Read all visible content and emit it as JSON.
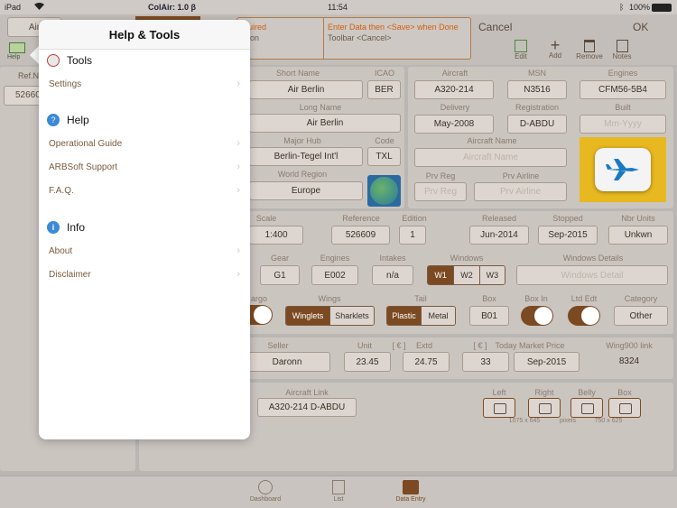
{
  "status": {
    "device": "iPad",
    "app": "ColAir: 1.0 β",
    "time": "11:54",
    "battery": "100%"
  },
  "toolbar": {
    "left_tab": "Air",
    "help_label": "Help",
    "hint_required": "uired",
    "hint_req2": "ion",
    "hint_enter": "Enter Data then <Save> when Done",
    "hint_toolbar": "Toolbar <Cancel>",
    "cancel": "Cancel",
    "ok": "OK",
    "edit": "Edit",
    "add": "Add",
    "remove": "Remove",
    "notes": "Notes"
  },
  "left_list": {
    "header": "Ref.N",
    "value": "52660"
  },
  "airline": {
    "short_name_label": "Short  Name",
    "short_name": "Air Berlin",
    "icao_label": "ICAO",
    "icao": "BER",
    "long_name_label": "Long Name",
    "long_name": "Air Berlin",
    "hub_label": "Major Hub",
    "hub": "Berlin-Tegel Int'l",
    "code_label": "Code",
    "code": "TXL",
    "region_label": "World Region",
    "region": "Europe"
  },
  "aircraft": {
    "aircraft_label": "Aircraft",
    "aircraft": "A320-214",
    "msn_label": "MSN",
    "msn": "N3516",
    "engines_label": "Engines",
    "engines": "CFM56-5B4",
    "delivery_label": "Delivery",
    "delivery": "May-2008",
    "registration_label": "Registration",
    "registration": "D-ABDU",
    "built_label": "Built",
    "built": "Mm-Yyyy",
    "name_label": "Aircraft Name",
    "name": "Aircraft Name",
    "prv_reg_label": "Prv Reg",
    "prv_reg": "Prv Reg",
    "prv_airline_label": "Prv Airline",
    "prv_airline": "Prv Airline"
  },
  "model": {
    "scale_label": "Scale",
    "scale": "1:400",
    "reference_label": "Reference",
    "reference": "526609",
    "edition_label": "Edition",
    "edition": "1",
    "released_label": "Released",
    "released": "Jun-2014",
    "stopped_label": "Stopped",
    "stopped": "Sep-2015",
    "units_label": "Nbr Units",
    "units": "Unkwn",
    "gear_label": "Gear",
    "gear": "G1",
    "engines_label": "Engines",
    "engines": "E002",
    "intakes_label": "Intakes",
    "intakes": "n/a",
    "windows_label": "Windows",
    "windows": [
      "W1",
      "W2",
      "W3"
    ],
    "windows_details_label": "Windows Details",
    "windows_details": "Windows Detail",
    "cargo_label": "argo",
    "wings_label": "Wings",
    "wings": [
      "Winglets",
      "Sharklets"
    ],
    "tail_label": "Tail",
    "tail": [
      "Plastic",
      "Metal"
    ],
    "box_label": "Box",
    "box": "B01",
    "boxin_label": "Box In",
    "ltd_label": "Ltd Edt",
    "category_label": "Category",
    "category": "Other"
  },
  "purchase": {
    "seller_label": "Seller",
    "seller": "Daronn",
    "unit_label": "Unit",
    "unit": "23.45",
    "cur1": "[ € ]",
    "extd_label": "Extd",
    "extd": "24.75",
    "cur2": "[ € ]",
    "market_label": "Today Market Price",
    "market": "33",
    "market_date": "Sep-2015",
    "wing900_label": "Wing900 link",
    "wing900": "8324"
  },
  "media": {
    "aircraft_link_label": "Aircraft Link",
    "aircraft_link": "A320-214  D-ABDU",
    "left": "Left",
    "right": "Right",
    "belly": "Belly",
    "box": "Box",
    "dims1": "1075 x 645",
    "pixels": "pixels",
    "dims2": "750 x 625"
  },
  "popover": {
    "title": "Help & Tools",
    "tools": "Tools",
    "settings": "Settings",
    "help": "Help",
    "guide": "Operational Guide",
    "support": "ARBSoft Support",
    "faq": "F.A.Q.",
    "info": "Info",
    "about": "About",
    "disclaimer": "Disclaimer"
  },
  "tabs": {
    "dashboard": "Dashboard",
    "list": "List",
    "entry": "Data Entry"
  }
}
